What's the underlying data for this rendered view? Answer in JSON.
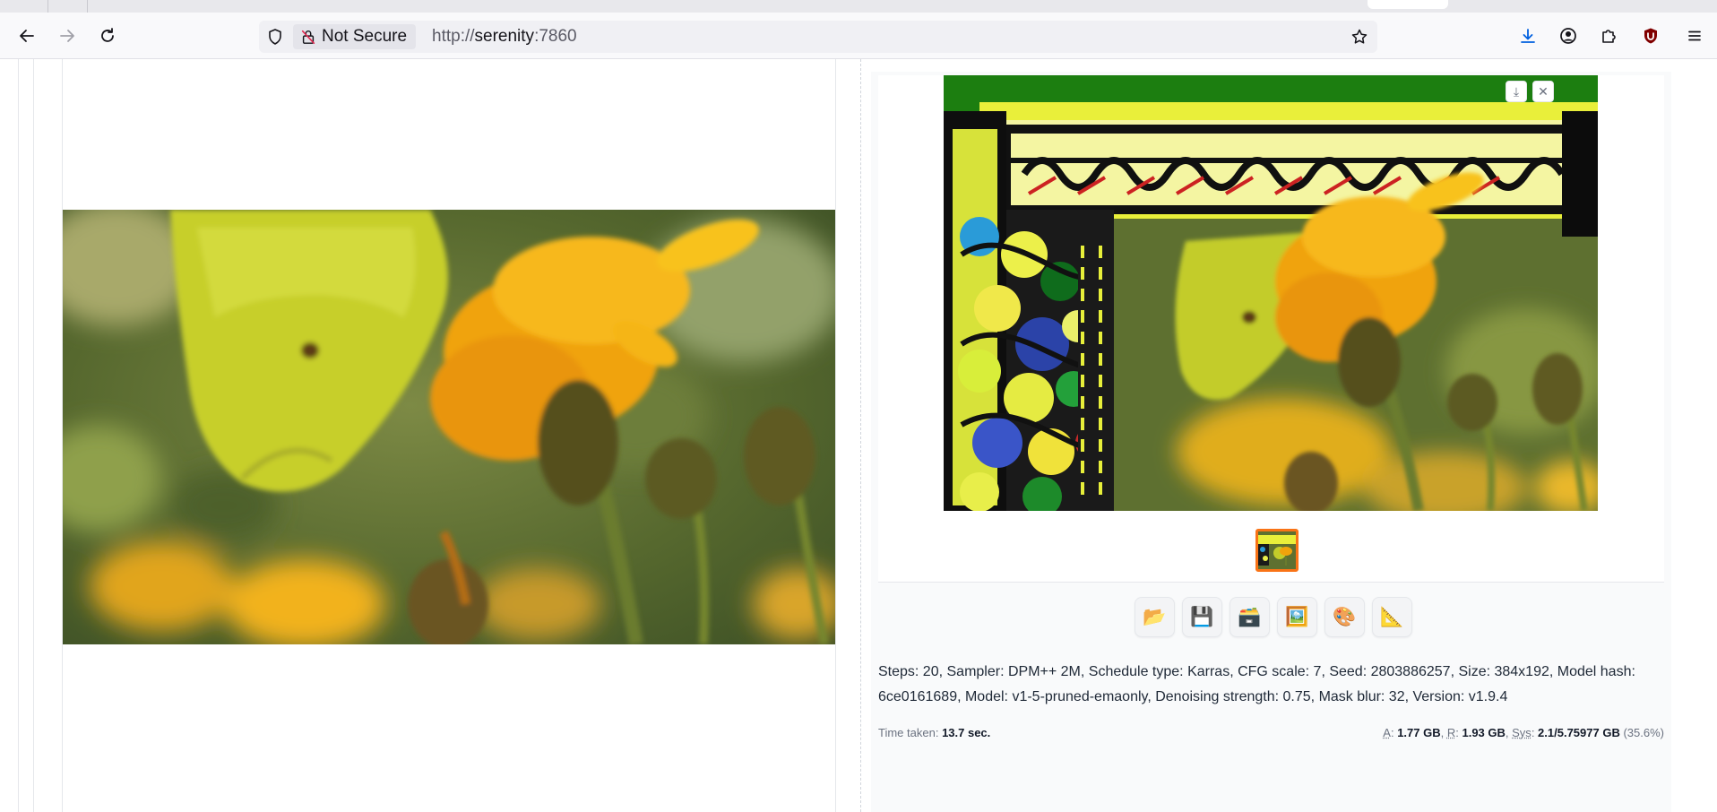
{
  "browser": {
    "security_label": "Not Secure",
    "url_scheme": "http://",
    "url_host": "serenity",
    "url_port": ":7860"
  },
  "icons": {
    "back": "back-arrow-icon",
    "forward": "forward-arrow-icon",
    "reload": "reload-icon",
    "shield": "shield-icon",
    "insecure_lock": "insecure-lock-icon",
    "bookmark": "star-icon",
    "downloads": "download-icon",
    "account": "account-icon",
    "extensions": "puzzle-icon",
    "ublock": "ublock-origin-icon",
    "menu": "hamburger-menu-icon"
  },
  "colors": {
    "selected_thumb_border": "#f97316",
    "download_icon": "#0060df",
    "ublock": "#800000"
  },
  "gallery": {
    "download_glyph": "⤓",
    "close_glyph": "✕"
  },
  "toolbar": {
    "buttons": [
      {
        "name": "open-folder",
        "glyph": "📂"
      },
      {
        "name": "save",
        "glyph": "💾"
      },
      {
        "name": "zip",
        "glyph": "🗃️"
      },
      {
        "name": "send-to-img2img",
        "glyph": "🖼️"
      },
      {
        "name": "send-to-inpaint",
        "glyph": "🎨"
      },
      {
        "name": "send-to-extras",
        "glyph": "📐"
      }
    ]
  },
  "generation_info": "Steps: 20, Sampler: DPM++ 2M, Schedule type: Karras, CFG scale: 7, Seed: 2803886257, Size: 384x192, Model hash: 6ce0161689, Model: v1-5-pruned-emaonly, Denoising strength: 0.75, Mask blur: 32, Version: v1.9.4",
  "stats": {
    "time_label": "Time taken:",
    "time_value": "13.7 sec.",
    "a_label": "A",
    "a_value": "1.77 GB",
    "r_label": "R",
    "r_value": "1.93 GB",
    "sys_label": "Sys",
    "sys_value": "2.1/5.75977 GB",
    "sys_percent": "(35.6%)"
  }
}
